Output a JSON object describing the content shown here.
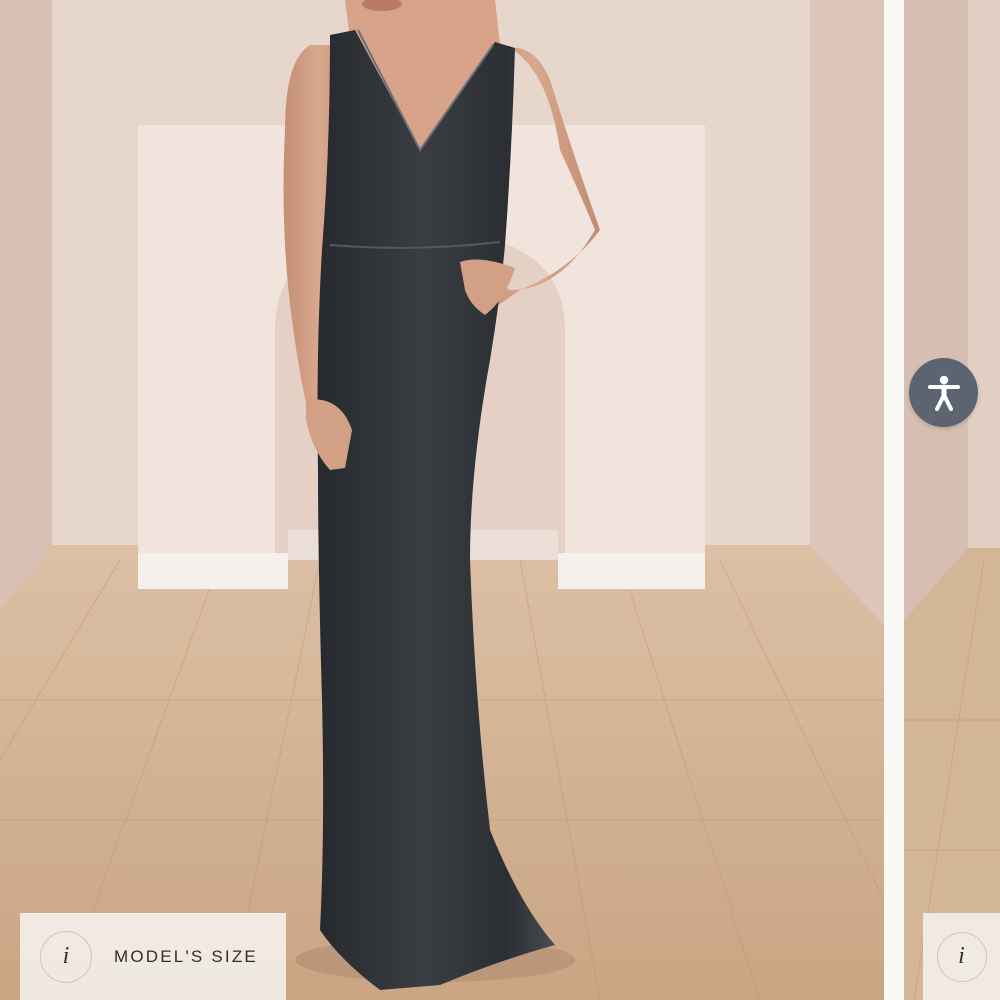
{
  "carousel": {
    "main_slide": {
      "image_alt": "Model wearing a charcoal velvet V-neck floor-length gown"
    },
    "model_size_button": {
      "icon": "info-icon",
      "icon_glyph": "i",
      "label": "MODEL'S SIZE"
    },
    "next_slide": {
      "model_size_button": {
        "icon": "info-icon",
        "icon_glyph": "i"
      }
    }
  },
  "accessibility_widget": {
    "icon": "accessibility-person-icon",
    "color": "#5b6470"
  },
  "colors": {
    "wall": "#e6d5cb",
    "floor": "#d3b597",
    "dress": "#2f3236",
    "background": "#f4f1ec"
  }
}
